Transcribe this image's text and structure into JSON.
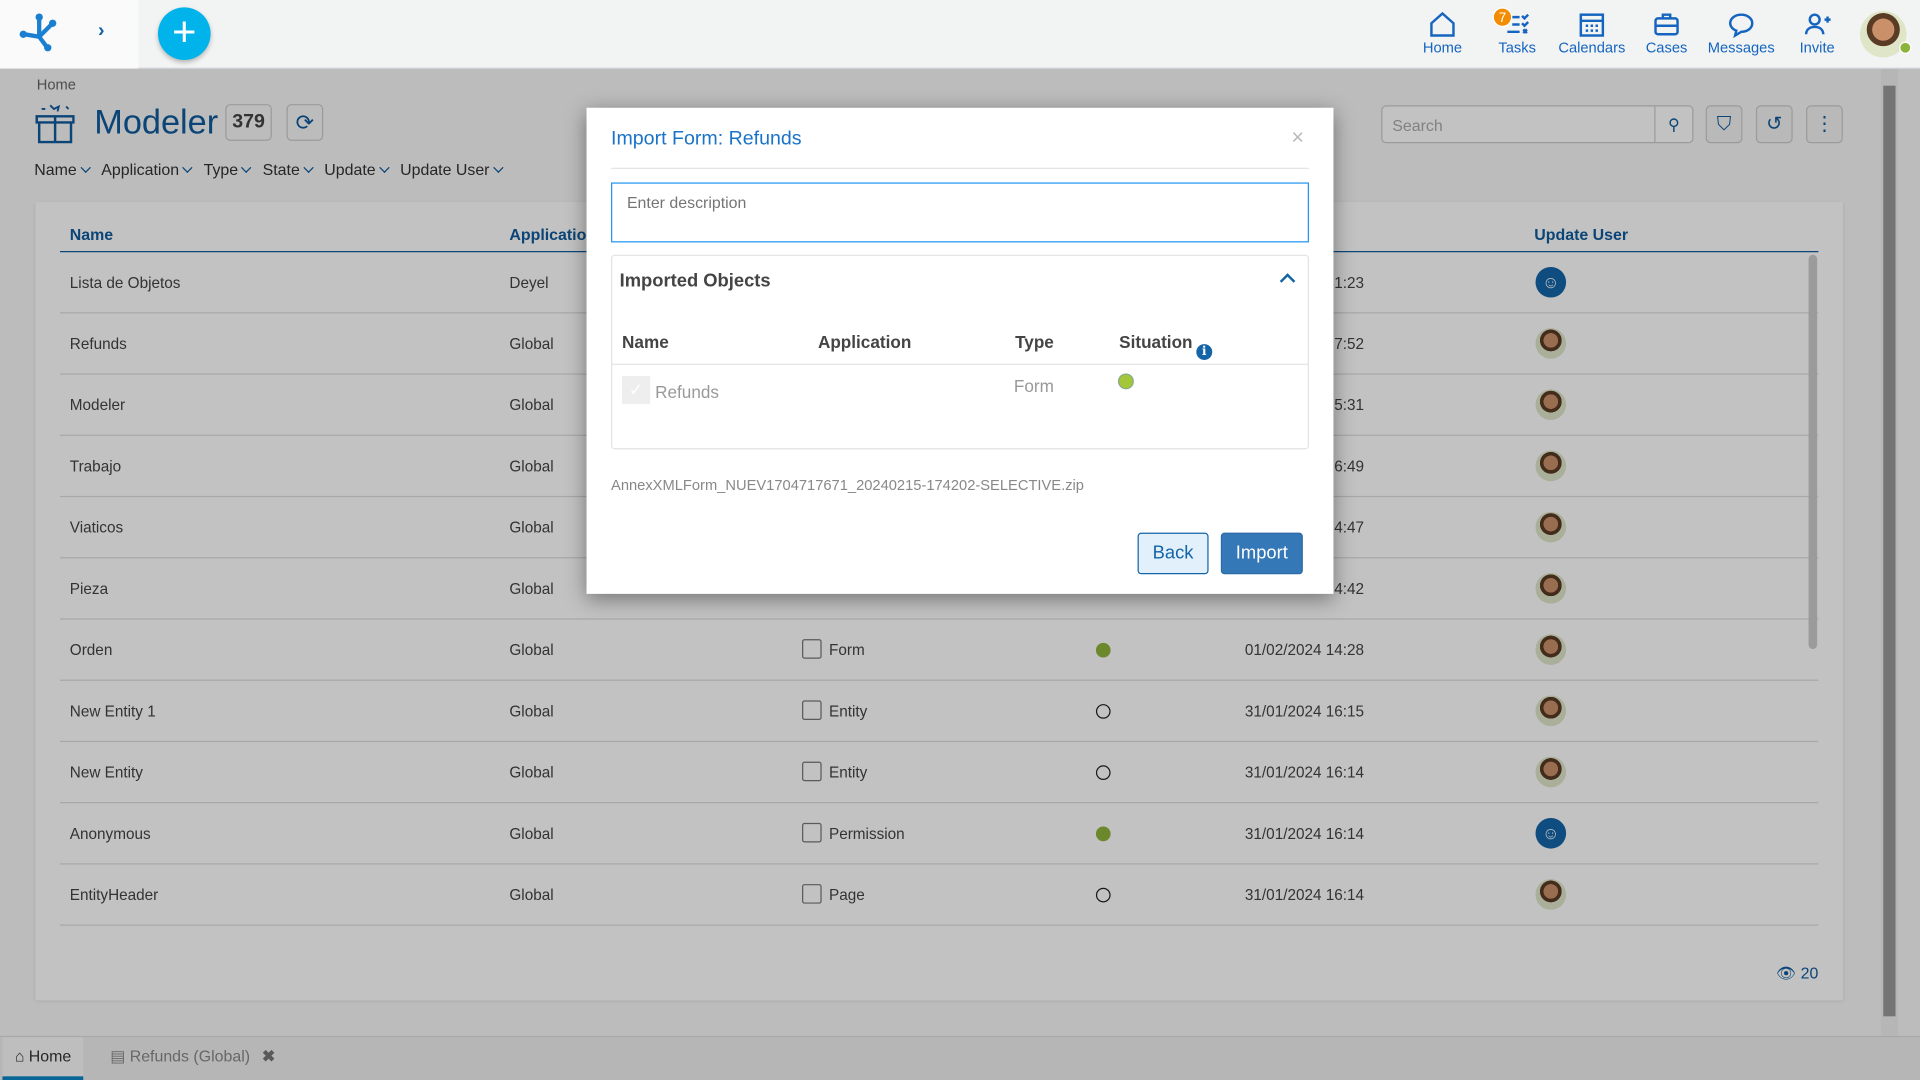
{
  "topbar": {
    "nav": [
      {
        "label": "Home",
        "icon": "home-icon"
      },
      {
        "label": "Tasks",
        "icon": "tasks-icon",
        "badge": "7"
      },
      {
        "label": "Calendars",
        "icon": "calendar-icon"
      },
      {
        "label": "Cases",
        "icon": "briefcase-icon"
      },
      {
        "label": "Messages",
        "icon": "chat-icon"
      },
      {
        "label": "Invite",
        "icon": "invite-user-icon"
      }
    ]
  },
  "page": {
    "breadcrumb": "Home",
    "title": "Modeler",
    "count": "379",
    "search_placeholder": "Search",
    "filters": [
      "Name",
      "Application",
      "Type",
      "State",
      "Update",
      "Update User"
    ],
    "columns": {
      "name": "Name",
      "application": "Application",
      "update_user": "Update User"
    },
    "rows": [
      {
        "name": "Lista de Objetos",
        "application": "Deyel",
        "type": "",
        "state": "",
        "update": "1:23",
        "user": "system"
      },
      {
        "name": "Refunds",
        "application": "Global",
        "type": "",
        "state": "",
        "update": "7:52",
        "user": "photo"
      },
      {
        "name": "Modeler",
        "application": "Global",
        "type": "",
        "state": "",
        "update": "5:31",
        "user": "photo"
      },
      {
        "name": "Trabajo",
        "application": "Global",
        "type": "",
        "state": "",
        "update": "6:49",
        "user": "photo"
      },
      {
        "name": "Viaticos",
        "application": "Global",
        "type": "",
        "state": "",
        "update": "4:47",
        "user": "photo"
      },
      {
        "name": "Pieza",
        "application": "Global",
        "type": "",
        "state": "",
        "update": "4:42",
        "user": "photo"
      },
      {
        "name": "Orden",
        "application": "Global",
        "type": "Form",
        "state": "active",
        "update": "01/02/2024 14:28",
        "user": "photo"
      },
      {
        "name": "New Entity 1",
        "application": "Global",
        "type": "Entity",
        "state": "inactive",
        "update": "31/01/2024 16:15",
        "user": "photo"
      },
      {
        "name": "New Entity",
        "application": "Global",
        "type": "Entity",
        "state": "inactive",
        "update": "31/01/2024 16:14",
        "user": "photo"
      },
      {
        "name": "Anonymous",
        "application": "Global",
        "type": "Permission",
        "state": "active",
        "update": "31/01/2024 16:14",
        "user": "system"
      },
      {
        "name": "EntityHeader",
        "application": "Global",
        "type": "Page",
        "state": "inactive",
        "update": "31/01/2024 16:14",
        "user": "photo"
      }
    ],
    "views": "20",
    "colors": {
      "active": "#8db43a",
      "brand": "#0f5a9c",
      "accent": "#00b3ea"
    }
  },
  "tabs": [
    {
      "label": "Home"
    },
    {
      "label": "Refunds (Global)"
    }
  ],
  "modal": {
    "title": "Import Form: Refunds",
    "description_placeholder": "Enter description",
    "panel_title": "Imported Objects",
    "columns": {
      "name": "Name",
      "application": "Application",
      "type": "Type",
      "situation": "Situation"
    },
    "item": {
      "name": "Refunds",
      "application": "",
      "type": "Form",
      "situation": "new",
      "checked": true
    },
    "file": "AnnexXMLForm_NUEV1704717671_20240215-174202-SELECTIVE.zip",
    "back": "Back",
    "import": "Import"
  }
}
